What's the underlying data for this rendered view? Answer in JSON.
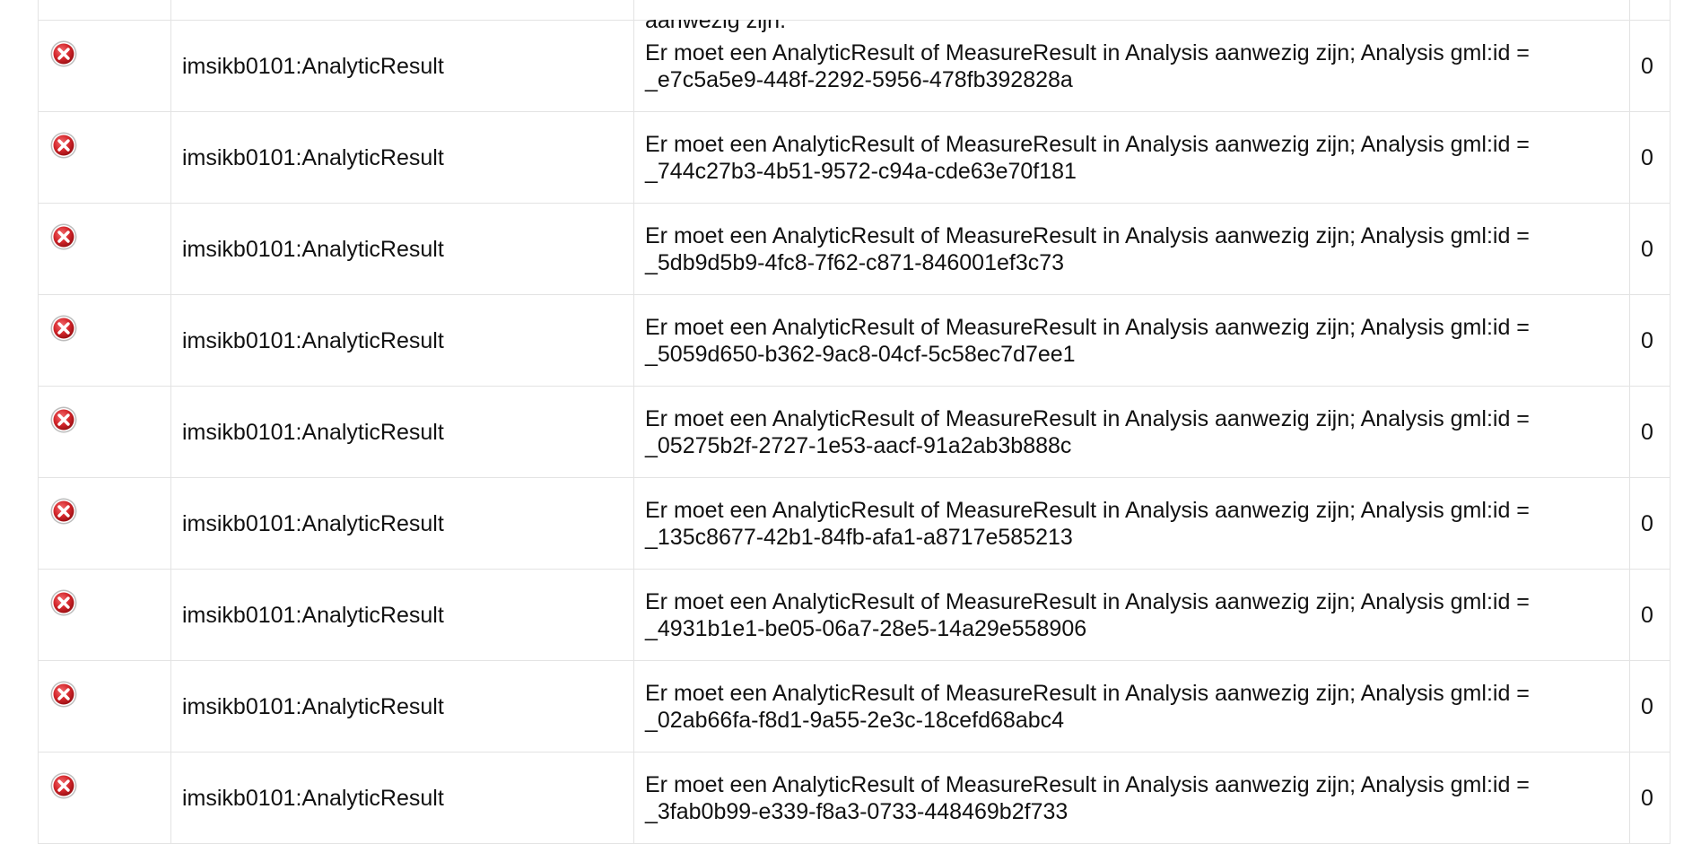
{
  "colors": {
    "icon_red": "#d4262b",
    "border": "#e3e3e3",
    "text": "#111111"
  },
  "partial_row": {
    "message_tail": "aanwezig zijn."
  },
  "rows": [
    {
      "icon": "error-icon",
      "name": "imsikb0101:AnalyticResult",
      "message": "Er moet een AnalyticResult of MeasureResult in Analysis aanwezig zijn; Analysis gml:id = _e7c5a5e9-448f-2292-5956-478fb392828a",
      "count": "0"
    },
    {
      "icon": "error-icon",
      "name": "imsikb0101:AnalyticResult",
      "message": "Er moet een AnalyticResult of MeasureResult in Analysis aanwezig zijn; Analysis gml:id = _744c27b3-4b51-9572-c94a-cde63e70f181",
      "count": "0"
    },
    {
      "icon": "error-icon",
      "name": "imsikb0101:AnalyticResult",
      "message": "Er moet een AnalyticResult of MeasureResult in Analysis aanwezig zijn; Analysis gml:id = _5db9d5b9-4fc8-7f62-c871-846001ef3c73",
      "count": "0"
    },
    {
      "icon": "error-icon",
      "name": "imsikb0101:AnalyticResult",
      "message": "Er moet een AnalyticResult of MeasureResult in Analysis aanwezig zijn; Analysis gml:id = _5059d650-b362-9ac8-04cf-5c58ec7d7ee1",
      "count": "0"
    },
    {
      "icon": "error-icon",
      "name": "imsikb0101:AnalyticResult",
      "message": "Er moet een AnalyticResult of MeasureResult in Analysis aanwezig zijn; Analysis gml:id = _05275b2f-2727-1e53-aacf-91a2ab3b888c",
      "count": "0"
    },
    {
      "icon": "error-icon",
      "name": "imsikb0101:AnalyticResult",
      "message": "Er moet een AnalyticResult of MeasureResult in Analysis aanwezig zijn; Analysis gml:id = _135c8677-42b1-84fb-afa1-a8717e585213",
      "count": "0"
    },
    {
      "icon": "error-icon",
      "name": "imsikb0101:AnalyticResult",
      "message": "Er moet een AnalyticResult of MeasureResult in Analysis aanwezig zijn; Analysis gml:id = _4931b1e1-be05-06a7-28e5-14a29e558906",
      "count": "0"
    },
    {
      "icon": "error-icon",
      "name": "imsikb0101:AnalyticResult",
      "message": "Er moet een AnalyticResult of MeasureResult in Analysis aanwezig zijn; Analysis gml:id = _02ab66fa-f8d1-9a55-2e3c-18cefd68abc4",
      "count": "0"
    },
    {
      "icon": "error-icon",
      "name": "imsikb0101:AnalyticResult",
      "message": "Er moet een AnalyticResult of MeasureResult in Analysis aanwezig zijn; Analysis gml:id = _3fab0b99-e339-f8a3-0733-448469b2f733",
      "count": "0"
    }
  ]
}
